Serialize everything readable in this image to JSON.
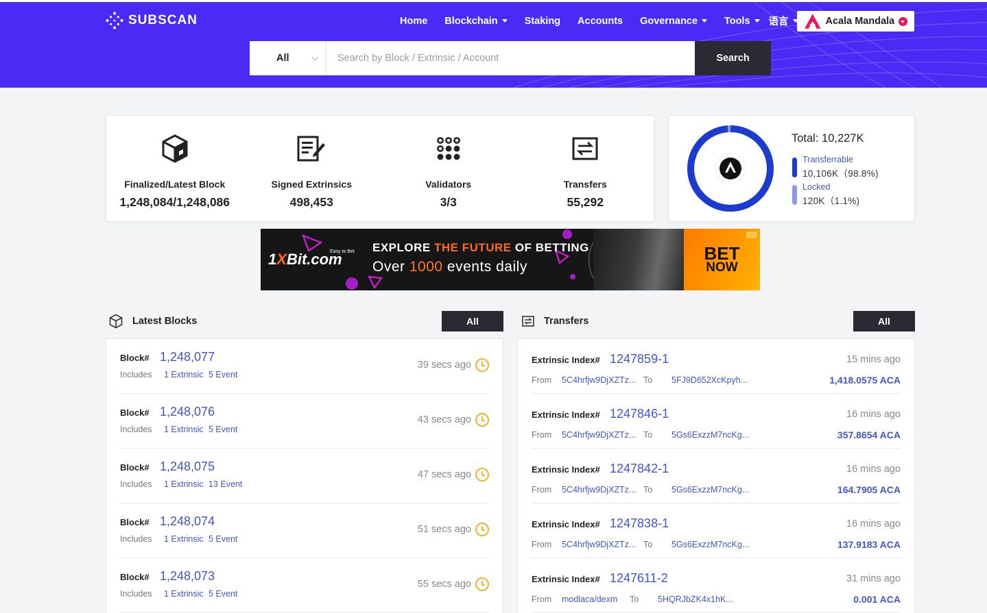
{
  "header": {
    "logo_text": "SUBSCAN",
    "nav": [
      "Home",
      "Blockchain",
      "Staking",
      "Accounts",
      "Governance",
      "Tools",
      "语言"
    ],
    "network": "Acala Mandala",
    "search": {
      "type": "All",
      "placeholder": "Search by Block / Extrinsic / Account",
      "button": "Search"
    }
  },
  "stats": [
    {
      "icon": "cube-icon",
      "label": "Finalized/Latest Block",
      "value": "1,248,084/1,248,086"
    },
    {
      "icon": "signed-document-icon",
      "label": "Signed Extrinsics",
      "value": "498,453"
    },
    {
      "icon": "validators-dots-icon",
      "label": "Validators",
      "value": "3/3"
    },
    {
      "icon": "transfer-arrows-icon",
      "label": "Transfers",
      "value": "55,292"
    }
  ],
  "supply": {
    "total": "Total: 10,227K",
    "transferrable_label": "Transferrable",
    "transferrable_value": "10,106K（98.8%)",
    "transferrable_fraction": 0.988,
    "locked_label": "Locked",
    "locked_value": "120K（1.1%)",
    "locked_fraction": 0.011,
    "colors": {
      "transferrable": "#1b3ccf",
      "locked": "#8a9ae8"
    }
  },
  "ad": {
    "brand_pre": "1",
    "brand_x": "X",
    "brand_post": "Bit.com",
    "tag": "Easy to Bet",
    "head_1": "EXPLORE",
    "head_2": "THE FUTURE",
    "head_3": "OF BETTING",
    "sub_1": "Over",
    "sub_2": "1000",
    "sub_3": "events daily",
    "btn_1": "BET",
    "btn_2": "NOW"
  },
  "blocks": {
    "title": "Latest Blocks",
    "all": "All",
    "block_label": "Block#",
    "includes_label": "Includes",
    "items": [
      {
        "number": "1,248,077",
        "extrinsics": "1 Extrinsic",
        "events": "5 Event",
        "time": "39 secs ago"
      },
      {
        "number": "1,248,076",
        "extrinsics": "1 Extrinsic",
        "events": "5 Event",
        "time": "43 secs ago"
      },
      {
        "number": "1,248,075",
        "extrinsics": "1 Extrinsic",
        "events": "13 Event",
        "time": "47 secs ago"
      },
      {
        "number": "1,248,074",
        "extrinsics": "1 Extrinsic",
        "events": "5 Event",
        "time": "51 secs ago"
      },
      {
        "number": "1,248,073",
        "extrinsics": "1 Extrinsic",
        "events": "5 Event",
        "time": "55 secs ago"
      }
    ]
  },
  "transfers": {
    "title": "Transfers",
    "all": "All",
    "index_label": "Extrinsic Index#",
    "from_label": "From",
    "to_label": "To",
    "items": [
      {
        "index": "1247859-1",
        "time": "15 mins ago",
        "from": "5C4hrfjw9DjXZTz...",
        "to": "5FJ9D652XcKpyh...",
        "amount": "1,418.0575 ACA"
      },
      {
        "index": "1247846-1",
        "time": "16 mins ago",
        "from": "5C4hrfjw9DjXZTz...",
        "to": "5Gs6ExzzM7ncKg...",
        "amount": "357.8654 ACA"
      },
      {
        "index": "1247842-1",
        "time": "16 mins ago",
        "from": "5C4hrfjw9DjXZTz...",
        "to": "5Gs6ExzzM7ncKg...",
        "amount": "164.7905 ACA"
      },
      {
        "index": "1247838-1",
        "time": "16 mins ago",
        "from": "5C4hrfjw9DjXZTz...",
        "to": "5Gs6ExzzM7ncKg...",
        "amount": "137.9183 ACA"
      },
      {
        "index": "1247611-2",
        "time": "31 mins ago",
        "from": "modlaca/dexm",
        "to": "5HQRJbZK4x1hK...",
        "amount": "0.001 ACA"
      }
    ]
  }
}
